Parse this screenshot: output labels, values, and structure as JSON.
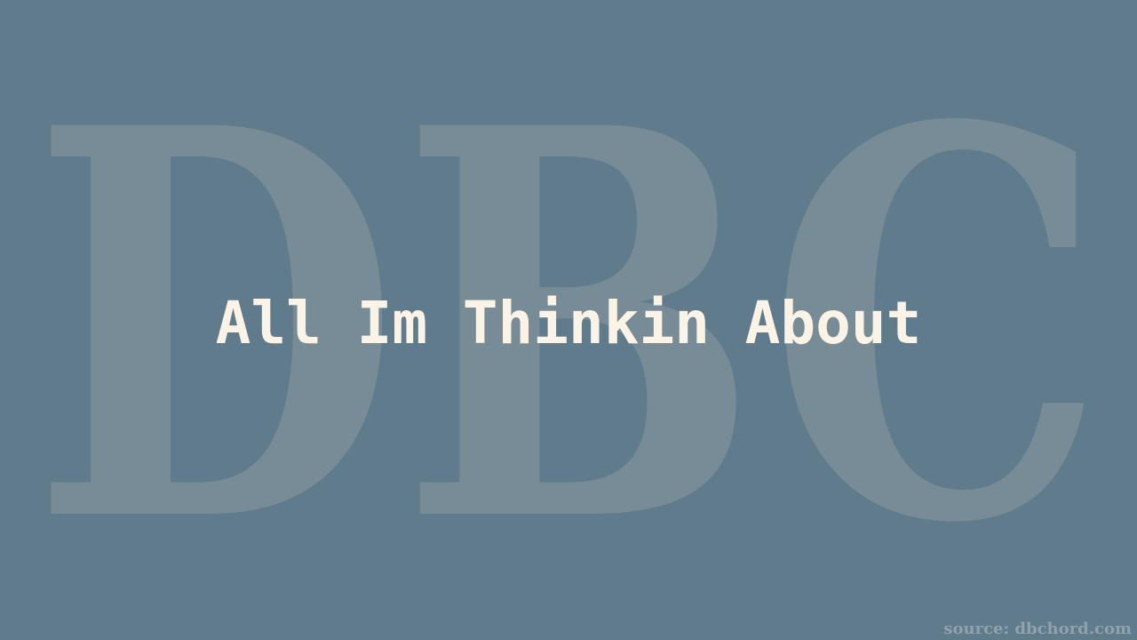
{
  "watermark": {
    "text": "DBC"
  },
  "title": "All Im Thinkin About",
  "source": "source: dbchord.com",
  "colors": {
    "background": "#5f7b8c",
    "watermark": "#788c98",
    "title": "#fbf3e6",
    "source": "#8fa2ae"
  }
}
